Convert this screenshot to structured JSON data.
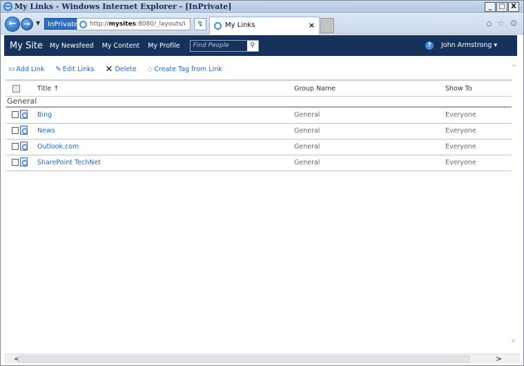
{
  "window": {
    "title": "My Links - Windows Internet Explorer - [InPrivate]",
    "controls": [
      "_",
      "□",
      "X"
    ]
  },
  "nav": {
    "inprivate_label": "InPrivate",
    "address_prefix": "http://",
    "address_host": "mysites",
    "address_rest": ":8080/_layouts/i",
    "tab_title": "My Links"
  },
  "ribbon": {
    "site_title": "My Site",
    "links": [
      "My Newsfeed",
      "My Content",
      "My Profile"
    ],
    "people_search_placeholder": "Find People",
    "user_name": "John Armstrong ▾"
  },
  "toolbar": {
    "add_link": "Add Link",
    "edit_links": "Edit Links",
    "delete": "Delete",
    "create_tag": "Create Tag from Link"
  },
  "table": {
    "columns": {
      "title": "Title ↑",
      "group": "Group Name",
      "show_to": "Show To"
    },
    "group_label": "General",
    "rows": [
      {
        "title": "Bing",
        "group": "General",
        "show_to": "Everyone"
      },
      {
        "title": "News",
        "group": "General",
        "show_to": "Everyone"
      },
      {
        "title": "Outlook.com",
        "group": "General",
        "show_to": "Everyone"
      },
      {
        "title": "SharePoint TechNet",
        "group": "General",
        "show_to": "Everyone"
      }
    ]
  },
  "colors": {
    "ribbon": "#16325a",
    "link": "#2266bb"
  }
}
